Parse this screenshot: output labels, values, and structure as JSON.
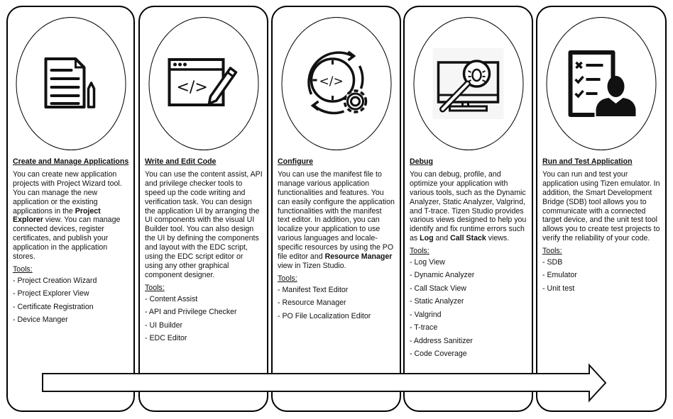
{
  "diagram": {
    "stages": [
      {
        "icon": "document-pencil-icon",
        "title": "Create and Manage Applications",
        "description_parts": [
          {
            "text": "You can create new application projects with Project Wizard tool. You can manage the new application or the existing applications in the "
          },
          {
            "text": "Project Explorer",
            "bold": true
          },
          {
            "text": " view. You can manage connected devices, register certificates, and publish your application in the application stores."
          }
        ],
        "tools_label": "Tools:",
        "tools": [
          "- Project  Creation Wizard",
          "- Project Explorer View",
          "- Certificate Registration",
          "- Device Manger"
        ]
      },
      {
        "icon": "code-editor-pencil-icon",
        "title": "Write and Edit Code",
        "description_parts": [
          {
            "text": "You can use the content assist, API and privilege checker tools to speed up the code writing and verification task. You can design the application UI by arranging the UI components with the visual UI Builder tool. You can also design the UI by defining the components and layout with the EDC script, using the EDC script editor or using any other graphical component designer."
          }
        ],
        "tools_label": "Tools:",
        "tools": [
          "- Content Assist",
          "- API and Privilege Checker",
          "- UI Builder",
          "- EDC Editor"
        ]
      },
      {
        "icon": "code-cycle-gear-icon",
        "title": "Configure",
        "description_parts": [
          {
            "text": "You can use the manifest file to manage various application functionalities and features. You can easily configure the application functionalities with the manifest text editor. In addition, you can localize your application to use various languages and locale-specific resources by using the PO file editor and "
          },
          {
            "text": "Resource Manager",
            "bold": true
          },
          {
            "text": " view in Tizen Studio."
          }
        ],
        "tools_label": "Tools:",
        "tools": [
          "- Manifest Text Editor",
          "- Resource Manager",
          "- PO File Localization Editor"
        ]
      },
      {
        "icon": "monitor-bug-magnifier-icon",
        "title": "Debug",
        "description_parts": [
          {
            "text": "You can debug, profile, and optimize your application with various tools, such as the Dynamic Analyzer, Static Analyzer, Valgrind, and T-trace. Tizen Studio provides various views designed to help you identify and fix runtime errors such as "
          },
          {
            "text": "Log",
            "bold": true
          },
          {
            "text": " and "
          },
          {
            "text": "Call Stack",
            "bold": true
          },
          {
            "text": " views."
          }
        ],
        "tools_label": "Tools:",
        "tools": [
          "- Log View",
          "- Dynamic Analyzer",
          "- Call Stack View",
          "- Static Analyzer",
          "- Valgrind",
          "- T-trace",
          "- Address Sanitizer",
          "- Code Coverage"
        ]
      },
      {
        "icon": "checklist-person-icon",
        "title": "Run and Test Application",
        "description_parts": [
          {
            "text": "You can run and test your application using Tizen emulator. In addition, the Smart Development Bridge (SDB) tool allows you to communicate with a connected target device, and the unit test tool allows you to create test projects to verify the reliability of your code."
          }
        ],
        "tools_label": "Tools:",
        "tools": [
          "- SDB",
          "- Emulator",
          "- Unit test"
        ]
      }
    ],
    "flow_arrow": "right-arrow"
  }
}
